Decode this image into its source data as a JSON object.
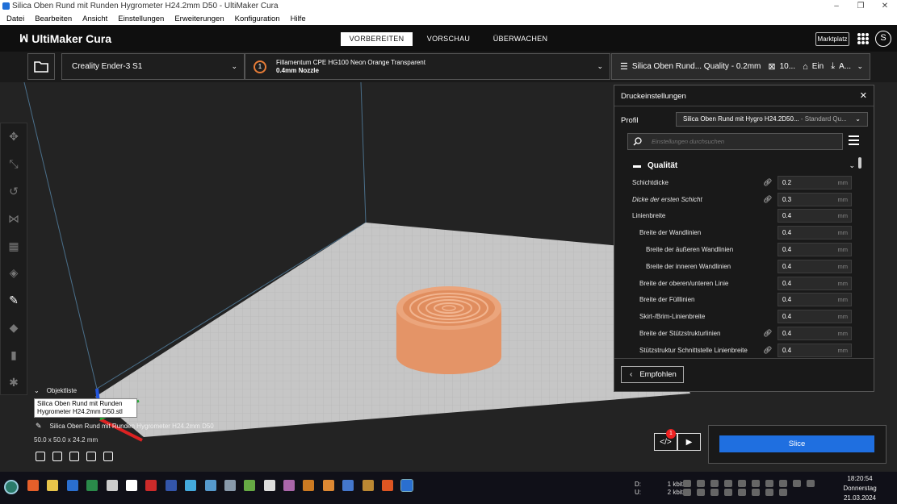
{
  "window": {
    "title": "Silica Oben Rund mit Runden Hygrometer H24.2mm D50 - UltiMaker Cura",
    "controls": [
      "–",
      "❐",
      "✕"
    ]
  },
  "menu": [
    "Datei",
    "Bearbeiten",
    "Ansicht",
    "Einstellungen",
    "Erweiterungen",
    "Konfiguration",
    "Hilfe"
  ],
  "header": {
    "logo": "UltiMaker Cura",
    "stages": [
      "VORBEREITEN",
      "VORSCHAU",
      "ÜBERWACHEN"
    ],
    "active_stage": "VORBEREITEN",
    "marketplace": "Marktplatz",
    "avatar": "S"
  },
  "toolbar": {
    "printer": "Creality Ender-3 S1",
    "extruder_number": "1",
    "material": "Fillamentum CPE HG100 Neon Orange Transparent",
    "nozzle": "0.4mm Nozzle",
    "profile_summary": "Silica Oben Rund... Quality - 0.2mm",
    "infill_value": "10...",
    "support_value": "Ein",
    "adhesion_value": "A..."
  },
  "object_list": {
    "header": "Objektliste",
    "tooltip": "Silica Oben Rund mit Runden Hygrometer H24.2mm D50.stl",
    "object_name": "Silica Oben Rund mit Runden Hygrometer H24.2mm D50",
    "dimensions": "50.0 x 50.0 x 24.2 mm"
  },
  "print_settings": {
    "title": "Druckeinstellungen",
    "profile_label": "Profil",
    "profile_name": "Silica Oben Rund mit Hygro H24.2D50...",
    "profile_quality": " - Standard Qu...",
    "search_placeholder": "Einstellungen durchsuchen",
    "category": "Qualität",
    "settings": [
      {
        "label": "Schichtdicke",
        "value": "0.2",
        "unit": "mm",
        "indent": 0,
        "linked": true,
        "italic": false
      },
      {
        "label": "Dicke der ersten Schicht",
        "value": "0.3",
        "unit": "mm",
        "indent": 0,
        "linked": true,
        "italic": true
      },
      {
        "label": "Linienbreite",
        "value": "0.4",
        "unit": "mm",
        "indent": 0,
        "linked": false,
        "italic": false
      },
      {
        "label": "Breite der Wandlinien",
        "value": "0.4",
        "unit": "mm",
        "indent": 1,
        "linked": false,
        "italic": false
      },
      {
        "label": "Breite der äußeren Wandlinien",
        "value": "0.4",
        "unit": "mm",
        "indent": 2,
        "linked": false,
        "italic": false
      },
      {
        "label": "Breite der inneren Wandlinien",
        "value": "0.4",
        "unit": "mm",
        "indent": 2,
        "linked": false,
        "italic": false
      },
      {
        "label": "Breite der oberen/unteren Linie",
        "value": "0.4",
        "unit": "mm",
        "indent": 1,
        "linked": false,
        "italic": false
      },
      {
        "label": "Breite der Fülllinien",
        "value": "0.4",
        "unit": "mm",
        "indent": 1,
        "linked": false,
        "italic": false
      },
      {
        "label": "Skirt-/Brim-Linienbreite",
        "value": "0.4",
        "unit": "mm",
        "indent": 1,
        "linked": false,
        "italic": false
      },
      {
        "label": "Breite der Stützstrukturlinien",
        "value": "0.4",
        "unit": "mm",
        "indent": 1,
        "linked": true,
        "italic": false
      },
      {
        "label": "Stützstruktur Schnittstelle Linienbreite",
        "value": "0.4",
        "unit": "mm",
        "indent": 1,
        "linked": true,
        "italic": false
      }
    ],
    "recommended_button": "Empfohlen"
  },
  "slice": {
    "button": "Slice",
    "badge": "1"
  },
  "taskbar": {
    "net_down_label": "D:",
    "net_down_value": "1 kbit/s",
    "net_up_label": "U:",
    "net_up_value": "2 kbit/s",
    "time": "18:20:54",
    "day": "Donnerstag",
    "date": "21.03.2024"
  },
  "colors": {
    "accent": "#1f6fe0",
    "model": "#e8956b",
    "plate": "#c8c8c8"
  }
}
